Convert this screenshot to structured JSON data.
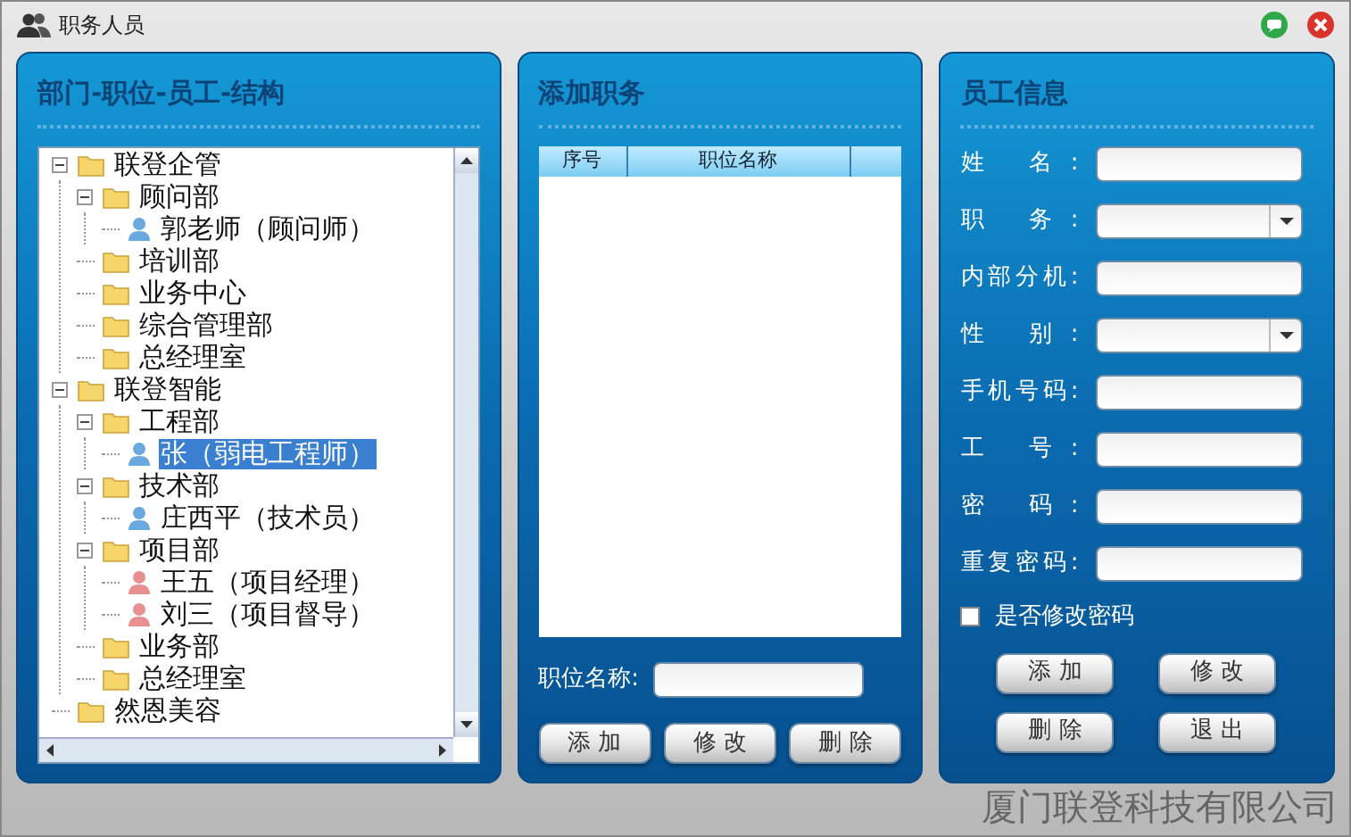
{
  "window": {
    "title": "职务人员"
  },
  "tree_panel": {
    "title": "部门-职位-员工-结构",
    "tree": [
      {
        "label": "联登企管",
        "kind": "folder",
        "expanded": true,
        "selected": false,
        "children": [
          {
            "label": "顾问部",
            "kind": "folder",
            "expanded": true,
            "selected": false,
            "children": [
              {
                "label": "郭老师（顾问师）",
                "kind": "person",
                "color": "#6aa8e0",
                "selected": false
              }
            ]
          },
          {
            "label": "培训部",
            "kind": "folder",
            "selected": false
          },
          {
            "label": "业务中心",
            "kind": "folder",
            "selected": false
          },
          {
            "label": "综合管理部",
            "kind": "folder",
            "selected": false
          },
          {
            "label": "总经理室",
            "kind": "folder",
            "selected": false
          }
        ]
      },
      {
        "label": "联登智能",
        "kind": "folder",
        "expanded": true,
        "selected": false,
        "children": [
          {
            "label": "工程部",
            "kind": "folder",
            "expanded": true,
            "selected": false,
            "children": [
              {
                "label": "张（弱电工程师）",
                "kind": "person",
                "color": "#6aa8e0",
                "selected": true
              }
            ]
          },
          {
            "label": "技术部",
            "kind": "folder",
            "expanded": true,
            "selected": false,
            "children": [
              {
                "label": "庄西平（技术员）",
                "kind": "person",
                "color": "#6aa8e0",
                "selected": false
              }
            ]
          },
          {
            "label": "项目部",
            "kind": "folder",
            "expanded": true,
            "selected": false,
            "children": [
              {
                "label": "王五（项目经理）",
                "kind": "person",
                "color": "#e89090",
                "selected": false
              },
              {
                "label": "刘三（项目督导）",
                "kind": "person",
                "color": "#e89090",
                "selected": false
              }
            ]
          },
          {
            "label": "业务部",
            "kind": "folder",
            "selected": false
          },
          {
            "label": "总经理室",
            "kind": "folder",
            "selected": false
          }
        ]
      },
      {
        "label": "然恩美容",
        "kind": "folder",
        "selected": false
      }
    ]
  },
  "position_panel": {
    "title": "添加职务",
    "table": {
      "columns": [
        "序号",
        "职位名称"
      ]
    },
    "name_field": {
      "label": "职位名称:"
    },
    "buttons": [
      "添 加",
      "修 改",
      "删 除"
    ]
  },
  "employee_panel": {
    "title": "员工信息",
    "fields": [
      {
        "label": "姓 名:",
        "kind": "text"
      },
      {
        "label": "职 务:",
        "kind": "select"
      },
      {
        "label": "内部分机:",
        "kind": "text"
      },
      {
        "label": "性 别:",
        "kind": "select"
      },
      {
        "label": "手机号码:",
        "kind": "text"
      },
      {
        "label": "工 号:",
        "kind": "text"
      },
      {
        "label": "密 码:",
        "kind": "text"
      },
      {
        "label": "重复密码:",
        "kind": "text"
      }
    ],
    "change_password": {
      "label": "是否修改密码",
      "checked": false
    },
    "buttons": [
      "添 加",
      "修 改",
      "删 除",
      "退 出"
    ]
  },
  "footer": "厦门联登科技有限公司"
}
